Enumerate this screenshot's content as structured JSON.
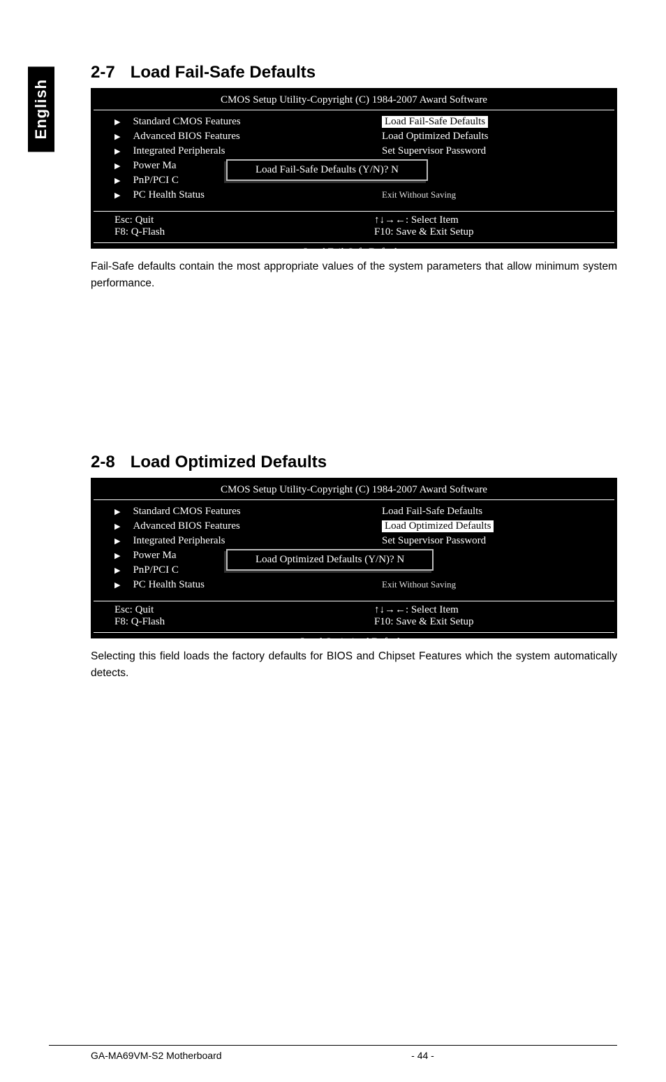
{
  "side_tab": "English",
  "section1": {
    "num": "2-7",
    "title": "Load Fail-Safe Defaults",
    "bios": {
      "title": "CMOS Setup Utility-Copyright (C) 1984-2007 Award Software",
      "left": [
        "Standard CMOS Features",
        "Advanced BIOS Features",
        "Integrated Peripherals",
        "Power Ma",
        "PnP/PCI C",
        "PC Health Status"
      ],
      "right": [
        "Load Fail-Safe Defaults",
        "Load Optimized Defaults",
        "Set Supervisor Password",
        "",
        "",
        "Exit Without Saving"
      ],
      "selected_right_index": 0,
      "dialog": "Load Fail-Safe Defaults (Y/N)? N",
      "hints": {
        "esc": "Esc: Quit",
        "select": "↑↓→←: Select Item",
        "f8": "F8: Q-Flash",
        "f10": "F10: Save & Exit Setup"
      },
      "footer": "Load Fail-Safe Defaults"
    },
    "desc": "Fail-Safe defaults contain the most appropriate values of the system parameters that allow minimum system performance."
  },
  "section2": {
    "num": "2-8",
    "title": "Load Optimized Defaults",
    "bios": {
      "title": "CMOS Setup Utility-Copyright (C) 1984-2007 Award Software",
      "left": [
        "Standard CMOS Features",
        "Advanced BIOS Features",
        "Integrated Peripherals",
        "Power Ma",
        "PnP/PCI C",
        "PC Health Status"
      ],
      "right": [
        "Load Fail-Safe Defaults",
        "Load Optimized Defaults",
        "Set Supervisor Password",
        "",
        "",
        "Exit Without Saving"
      ],
      "selected_right_index": 1,
      "dialog": "Load Optimized Defaults (Y/N)? N",
      "hints": {
        "esc": "Esc: Quit",
        "select": "↑↓→←: Select Item",
        "f8": "F8: Q-Flash",
        "f10": "F10: Save & Exit Setup"
      },
      "footer": "Load Optimized Defaults"
    },
    "desc": "Selecting this field loads the factory defaults for BIOS and Chipset Features which the system automatically detects."
  },
  "footer": {
    "model": "GA-MA69VM-S2 Motherboard",
    "page": "- 44 -"
  }
}
